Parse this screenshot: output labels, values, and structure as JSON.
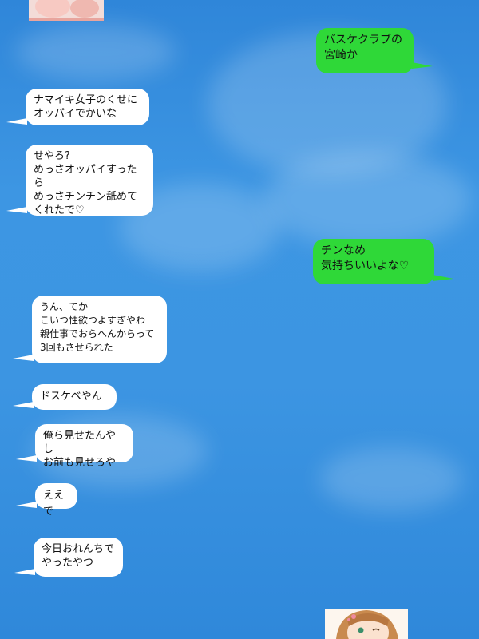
{
  "messages": {
    "out1": "バスケクラブの\n宮崎か",
    "in1": "ナマイキ女子のくせに\nオッパイでかいな",
    "in2": "せやろ?\nめっさオッパイすったら\nめっさチンチン舐めて\nくれたで♡",
    "out2": "チンなめ\n気持ちいいよな♡",
    "in3": "うん、てか\nこいつ性欲つよすぎやわ\n親仕事でおらへんからって\n3回もさせられた",
    "in4": "ドスケベやん",
    "in5": "俺ら見せたんやし\nお前も見せろや",
    "in6": "ええで",
    "in7": "今日おれんちで\nやったやつ"
  },
  "colors": {
    "sky": "#3d96e3",
    "incoming_bubble": "#ffffff",
    "outgoing_bubble": "#2fd838"
  },
  "images": {
    "top_thumbnail": "partial-photo-thumbnail",
    "bottom_thumbnail": "anime-girl-photo-thumbnail"
  }
}
